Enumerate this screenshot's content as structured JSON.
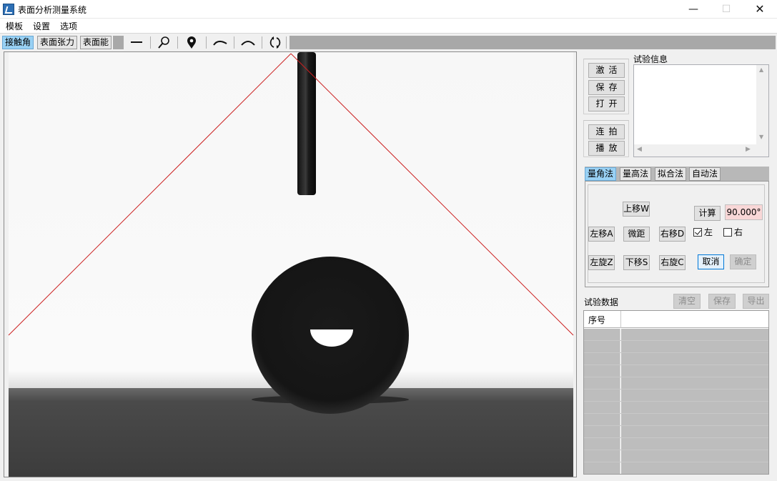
{
  "window": {
    "title": "表面分析测量系统",
    "min": "—",
    "max": "☐",
    "close": "✕"
  },
  "menu": [
    "模板",
    "设置",
    "选项"
  ],
  "mode_tabs": [
    "接触角",
    "表面张力",
    "表面能"
  ],
  "active_mode_tab": "接触角",
  "tools": [
    "line-tool-icon",
    "magnifier-icon",
    "location-pin-icon",
    "arc-left-icon",
    "arc-right-icon",
    "refresh-circle-icon"
  ],
  "camera_group": {
    "activate": "激活",
    "save": "保存",
    "open": "打开"
  },
  "capture_group": {
    "burst": "连拍",
    "play": "播放"
  },
  "test_info": {
    "label": "试验信息",
    "value": ""
  },
  "method_tabs": [
    "量角法",
    "量高法",
    "拟合法",
    "自动法"
  ],
  "active_method_tab": "量角法",
  "angle_controls": {
    "move_up": "上移W",
    "move_left": "左移A",
    "fine": "微距",
    "move_right": "右移D",
    "rotate_left": "左旋Z",
    "move_down": "下移S",
    "rotate_right": "右旋C",
    "calculate": "计算",
    "result": "90.000°",
    "left_label": "左",
    "left_checked": true,
    "right_label": "右",
    "right_checked": false,
    "cancel": "取消",
    "confirm": "确定"
  },
  "test_data": {
    "label": "试验数据",
    "clear": "清空",
    "save": "保存",
    "export": "导出",
    "column_header": "序号",
    "row_count": 12
  },
  "colors": {
    "active_tab": "#99d1f4",
    "result_bg": "#f8d7d7",
    "measure_line": "#cc2020"
  }
}
